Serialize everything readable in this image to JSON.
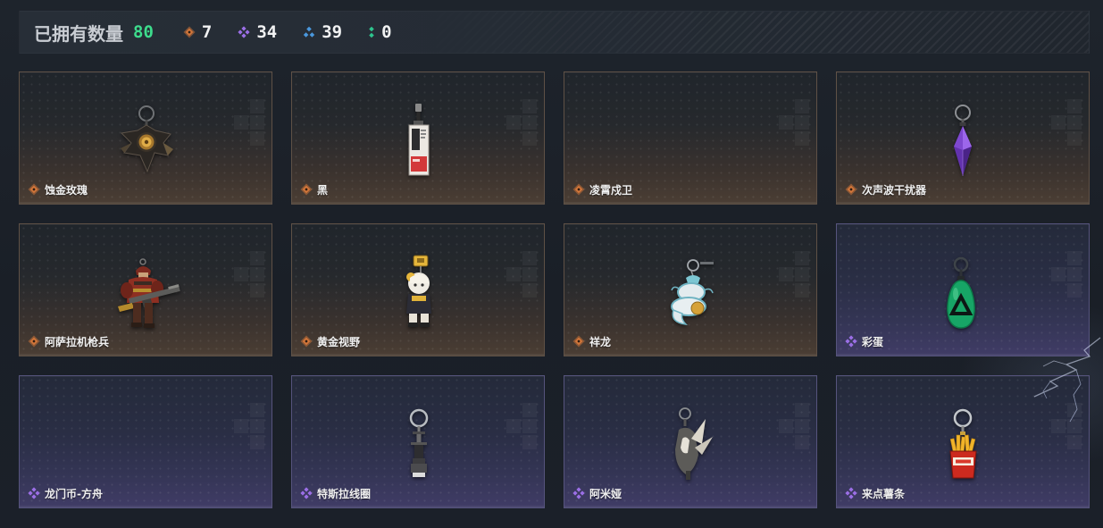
{
  "header": {
    "owned_label": "已拥有数量",
    "owned_count": "80",
    "rarity_counts": [
      {
        "rarity": "orange",
        "icon": "orange-rarity-icon",
        "count": "7"
      },
      {
        "rarity": "purple",
        "icon": "purple-rarity-icon",
        "count": "34"
      },
      {
        "rarity": "blue",
        "icon": "blue-rarity-icon",
        "count": "39"
      },
      {
        "rarity": "green",
        "icon": "green-rarity-icon",
        "count": "0"
      }
    ]
  },
  "colors": {
    "owned_count": "#3ddc8c",
    "orange": "#d5773a",
    "purple": "#9b6fe6",
    "blue": "#4a98de",
    "green": "#2ec48e"
  },
  "items": [
    {
      "name": "蚀金玫瑰",
      "rarity": "orange",
      "icon": "gilded-rose-charm-icon"
    },
    {
      "name": "黑",
      "rarity": "orange",
      "icon": "black-tag-charm-icon"
    },
    {
      "name": "凌霄戍卫",
      "rarity": "orange"
    },
    {
      "name": "次声波干扰器",
      "rarity": "orange",
      "icon": "purple-crystal-charm-icon"
    },
    {
      "name": "阿萨拉机枪兵",
      "rarity": "orange",
      "icon": "machine-gunner-figure-icon"
    },
    {
      "name": "黄金视野",
      "rarity": "orange",
      "icon": "golden-figure-charm-icon"
    },
    {
      "name": "祥龙",
      "rarity": "orange",
      "icon": "dragon-charm-icon"
    },
    {
      "name": "彩蛋",
      "rarity": "purple",
      "icon": "green-egg-charm-icon"
    },
    {
      "name": "龙门币-方舟",
      "rarity": "purple"
    },
    {
      "name": "特斯拉线圈",
      "rarity": "purple",
      "icon": "tesla-coil-charm-icon"
    },
    {
      "name": "阿米娅",
      "rarity": "purple",
      "icon": "rabbit-hood-charm-icon"
    },
    {
      "name": "来点薯条",
      "rarity": "purple",
      "icon": "fries-charm-icon"
    }
  ]
}
